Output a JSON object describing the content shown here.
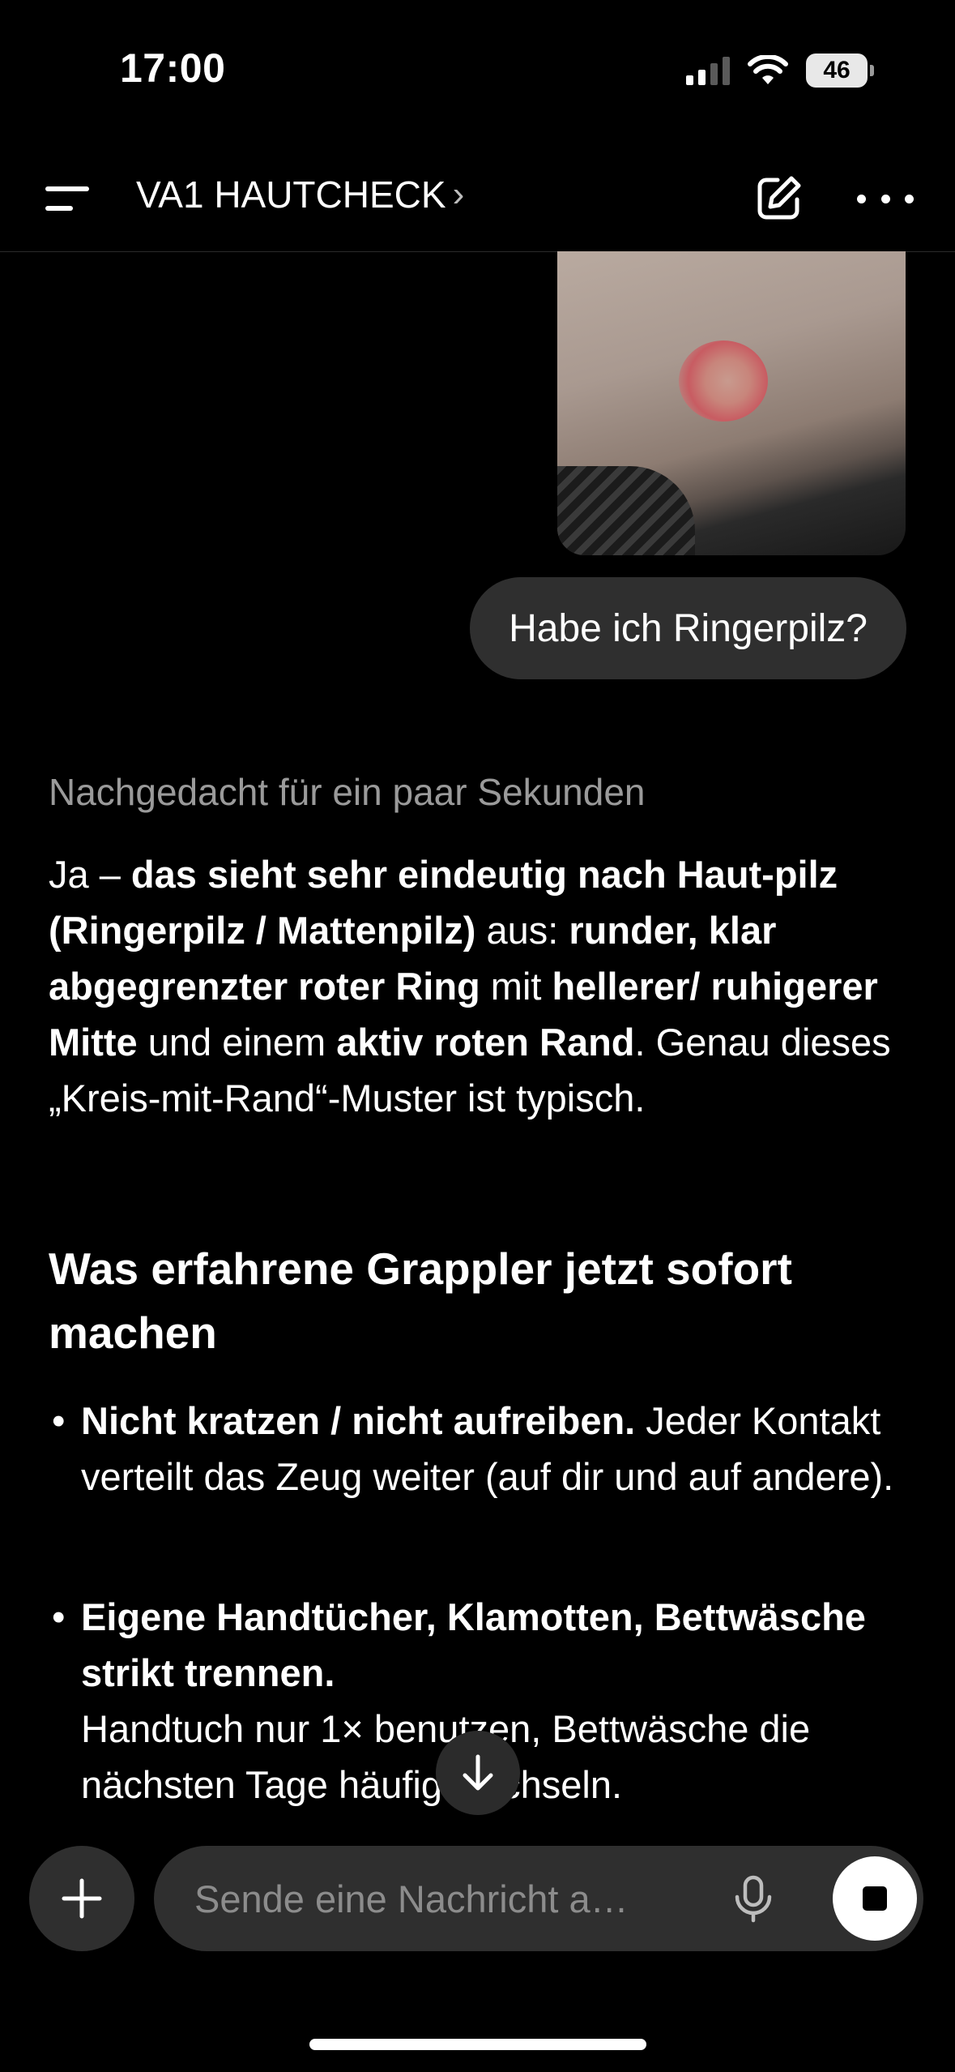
{
  "status_bar": {
    "time": "17:00",
    "battery": "46"
  },
  "header": {
    "title": "VA1 HAUTCHECK",
    "title_chevron": "›"
  },
  "conversation": {
    "user_image": "skin photo",
    "user_message": "Habe ich Ringerpilz?",
    "thinking_note": "Nachgedacht für ein paar Sekunden",
    "answer": {
      "p1": [
        "Ja – ",
        "das sieht sehr eindeutig nach Haut-pilz (Ringerpilz / Mattenpilz)",
        " aus: ",
        "runder, klar abgegrenzter roter Ring",
        " mit ",
        "hellerer/ ruhigerer Mitte",
        " und einem ",
        "aktiv roten Rand",
        ". Genau dieses „Kreis-mit-Rand“-Muster ist typisch."
      ],
      "heading": "Was erfahrene Grappler jetzt sofort machen",
      "bullets": [
        {
          "bold": "Nicht kratzen / nicht aufreiben.",
          "text": " Jeder Kontakt verteilt das Zeug weiter (auf dir und auf andere)."
        },
        {
          "bold": "Eigene Handtücher, Klamotten, Bettwäsche strikt trennen.",
          "text": "Handtuch nur 1× benutzen, Bettwäsche die nächsten Tage häufig wechseln."
        }
      ]
    }
  },
  "composer": {
    "placeholder": "Sende eine Nachricht a…"
  },
  "icons": {
    "menu": "menu-icon",
    "edit": "compose-icon",
    "more": "more-dots-icon",
    "scroll": "arrow-down-icon",
    "plus": "plus-icon",
    "mic": "microphone-icon",
    "stop": "stop-icon"
  }
}
